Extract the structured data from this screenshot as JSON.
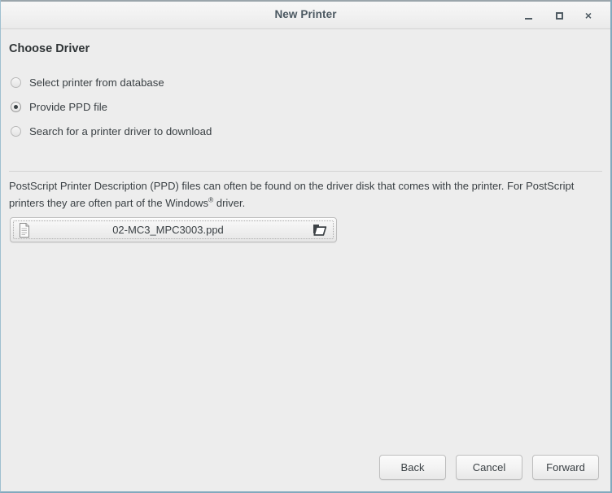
{
  "window": {
    "title": "New Printer",
    "controls": {
      "minimize": "minimize-icon",
      "maximize": "maximize-icon",
      "close": "close-icon",
      "close_glyph": "×"
    }
  },
  "page": {
    "heading": "Choose Driver",
    "driver_options": [
      {
        "label": "Select printer from database",
        "selected": false
      },
      {
        "label": "Provide PPD file",
        "selected": true
      },
      {
        "label": "Search for a printer driver to download",
        "selected": false
      }
    ],
    "description_part1": "PostScript Printer Description (PPD) files can often be found on the driver disk that comes with the printer. For PostScript printers they are often part of the Windows",
    "description_sup": "®",
    "description_part2": " driver.",
    "file_chooser": {
      "file_name": "02-MC3_MPC3003.ppd",
      "document_icon": "document-icon",
      "open_icon": "open-file-icon"
    }
  },
  "actions": {
    "back": "Back",
    "cancel": "Cancel",
    "forward": "Forward"
  },
  "colors": {
    "window_background": "#ededed",
    "titlebar_top": "#f7f7f7",
    "outer_border": "#82a9bd",
    "title_text": "#4a5760",
    "body_text": "#3a4044",
    "separator": "#d3d3d3"
  }
}
